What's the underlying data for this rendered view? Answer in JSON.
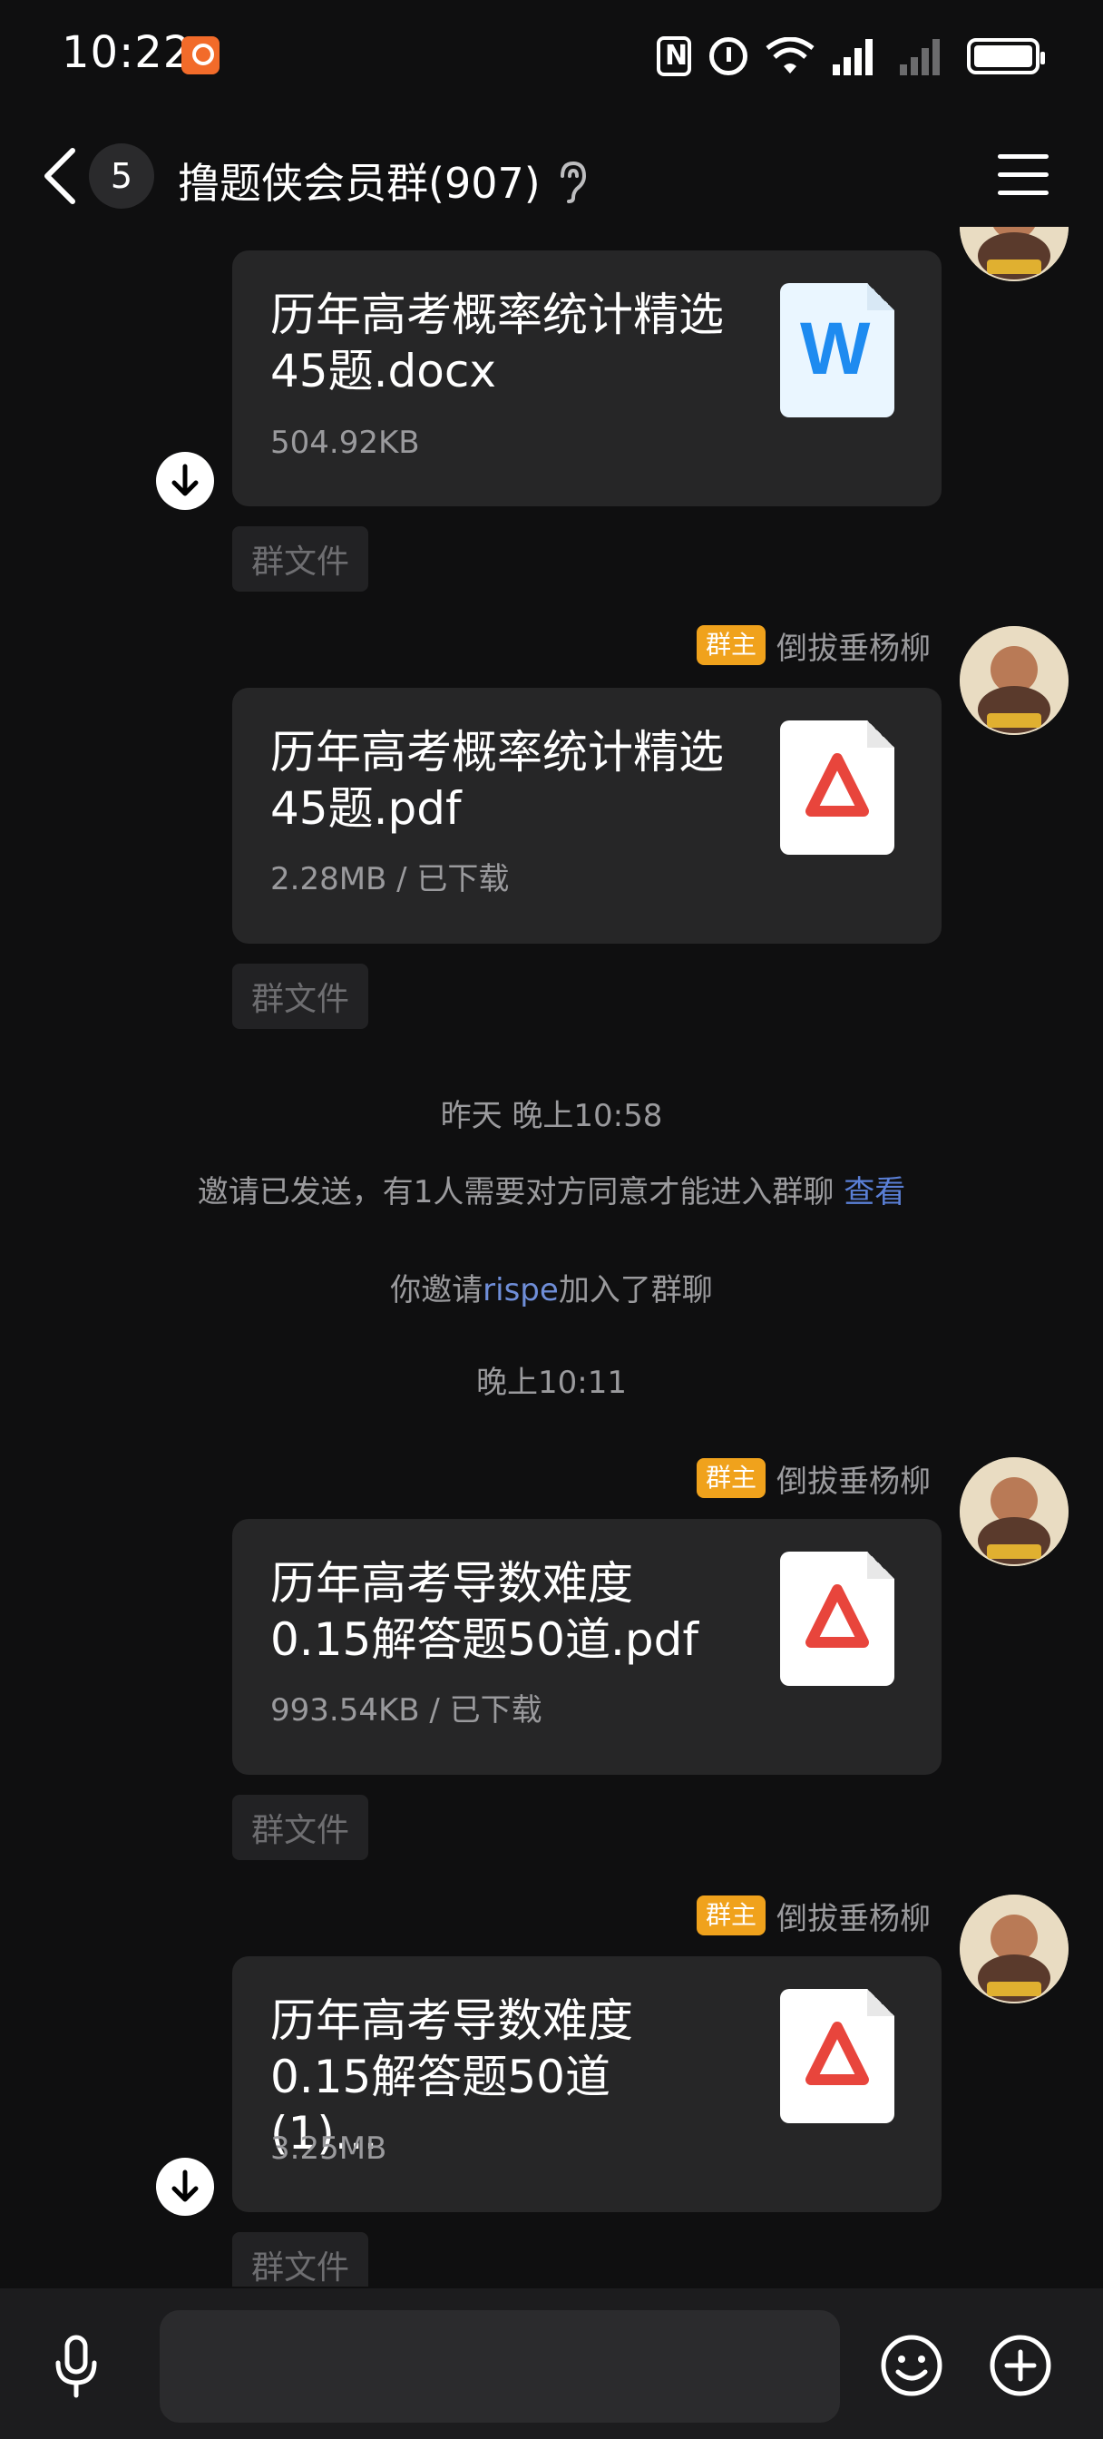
{
  "status_bar": {
    "time": "10:22",
    "icons": [
      "nfc-icon",
      "alarm-icon",
      "wifi-icon",
      "signal-icon",
      "signal-2-icon",
      "battery-icon"
    ]
  },
  "header": {
    "unread_count": "5",
    "title": "撸题侠会员群(907)"
  },
  "messages": [
    {
      "file_name": "历年高考概率统计精选45题.docx",
      "meta": "504.92KB",
      "type": "word",
      "tag": "群文件"
    },
    {
      "sender_badge": "群主",
      "sender_name": "倒拔垂杨柳",
      "file_name": "历年高考概率统计精选45题.pdf",
      "meta": "2.28MB / 已下载",
      "type": "pdf",
      "tag": "群文件"
    },
    {
      "sender_badge": "群主",
      "sender_name": "倒拔垂杨柳",
      "file_name": "历年高考导数难度0.15解答题50道.pdf",
      "meta": "993.54KB / 已下载",
      "type": "pdf",
      "tag": "群文件"
    },
    {
      "sender_badge": "群主",
      "sender_name": "倒拔垂杨柳",
      "file_name": "历年高考导数难度0.15解答题50道 (1)...",
      "meta": "3.25MB",
      "type": "pdf",
      "tag": "群文件"
    }
  ],
  "system": {
    "time1": "昨天 晚上10:58",
    "invite_notice": "邀请已发送，有1人需要对方同意才能进入群聊",
    "invite_link": "查看",
    "joined_prefix": "你邀请",
    "joined_user": "rispe",
    "joined_suffix": "加入了群聊",
    "time2": "晚上10:11"
  },
  "input": {
    "placeholder": ""
  },
  "colors": {
    "background": "#0f0f10",
    "bubble": "#262627",
    "owner_badge": "#f0a21c",
    "link": "#5a7fd6",
    "pdf_red": "#e8453c",
    "word_blue": "#1e8bf0"
  }
}
